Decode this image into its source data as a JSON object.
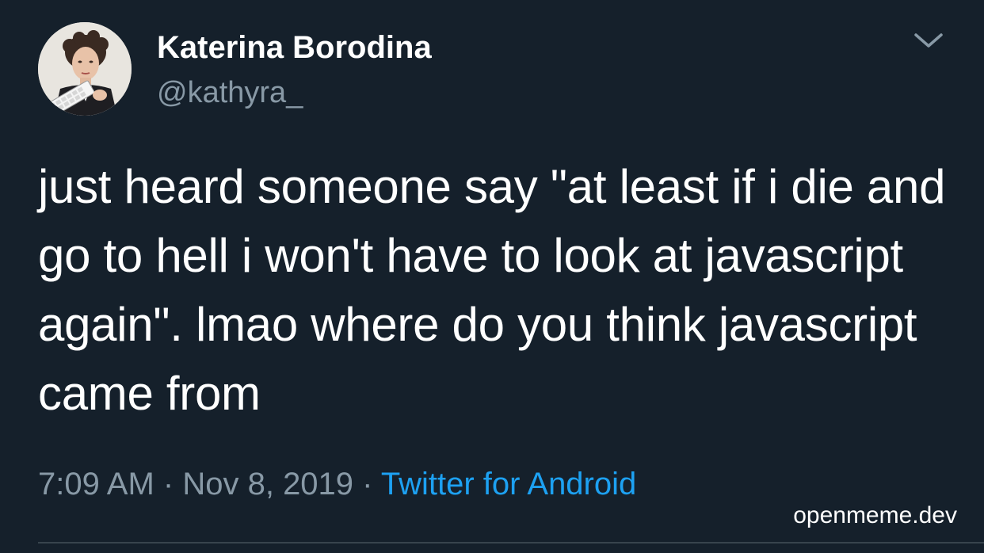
{
  "author": {
    "display_name": "Katerina Borodina",
    "handle": "@kathyra_"
  },
  "tweet": {
    "text": "just heard someone say \"at least if i die and go to hell i won't have to look at javascript again\". lmao where do you think javascript came from",
    "time": "7:09 AM",
    "separator": "·",
    "date": "Nov 8, 2019",
    "source": "Twitter for Android"
  },
  "watermark": "openmeme.dev",
  "icons": {
    "options": "chevron-down-icon",
    "avatar": "avatar"
  },
  "colors": {
    "background": "#15202b",
    "text": "#ffffff",
    "secondary": "#8899a6",
    "link": "#1da1f2",
    "divider": "#38444d"
  }
}
